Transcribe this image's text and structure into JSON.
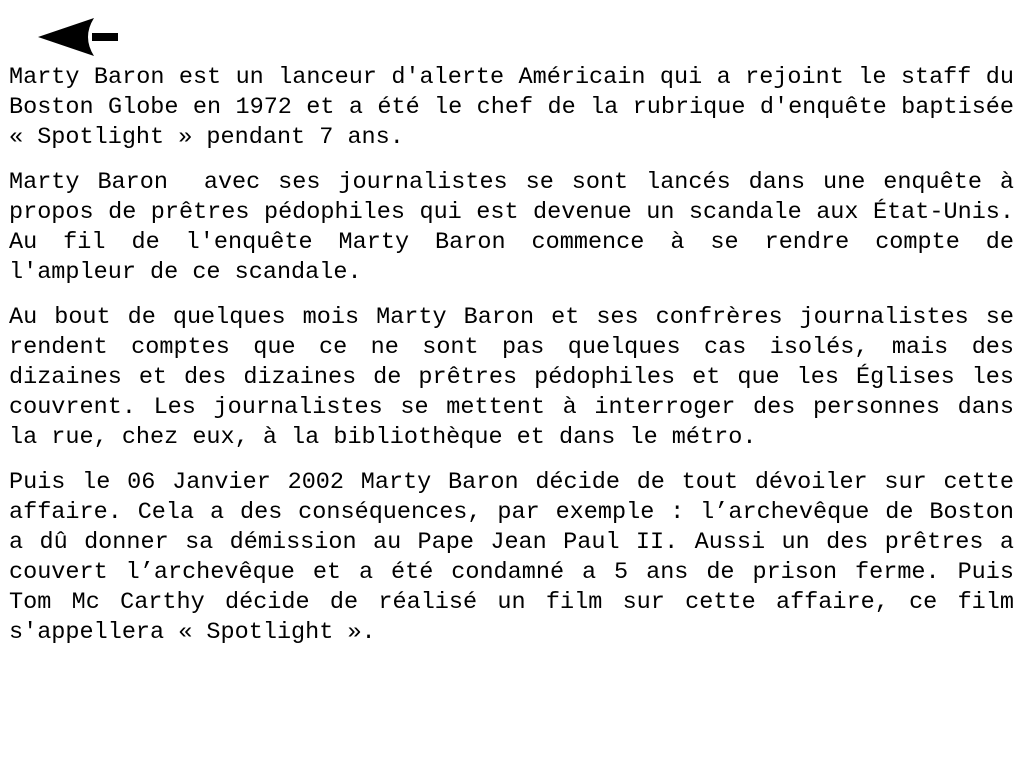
{
  "navigation": {
    "back_icon": "back-arrow-icon"
  },
  "paragraphs": [
    "Marty Baron est un lanceur d'alerte Américain qui a rejoint le staff du Boston Globe en 1972 et a été le chef de la rubrique d'enquête baptisée  « Spotlight » pendant 7 ans.",
    "Marty Baron  avec ses journalistes se sont lancés dans une enquête à propos de prêtres pédophiles qui est devenue un scandale aux État-Unis. Au fil de l'enquête Marty Baron commence à se rendre compte de l'ampleur de ce scandale.",
    "Au bout de quelques mois Marty Baron et ses confrères journalistes se rendent comptes que ce ne sont pas quelques cas isolés, mais des dizaines et des dizaines de prêtres pédophiles et que les Églises les couvrent. Les journalistes se mettent à interroger des personnes dans la rue, chez eux, à la bibliothèque et dans le métro.",
    "Puis le 06 Janvier 2002 Marty Baron décide de tout dévoiler sur cette affaire. Cela a des conséquences, par exemple : l’archevêque de Boston a dû donner sa démission au Pape Jean Paul II. Aussi un des prêtres a couvert l’archevêque et a été condamné a 5 ans de prison ferme. Puis  Tom Mc Carthy décide de réalisé un film sur cette affaire, ce film s'appellera « Spotlight »."
  ]
}
